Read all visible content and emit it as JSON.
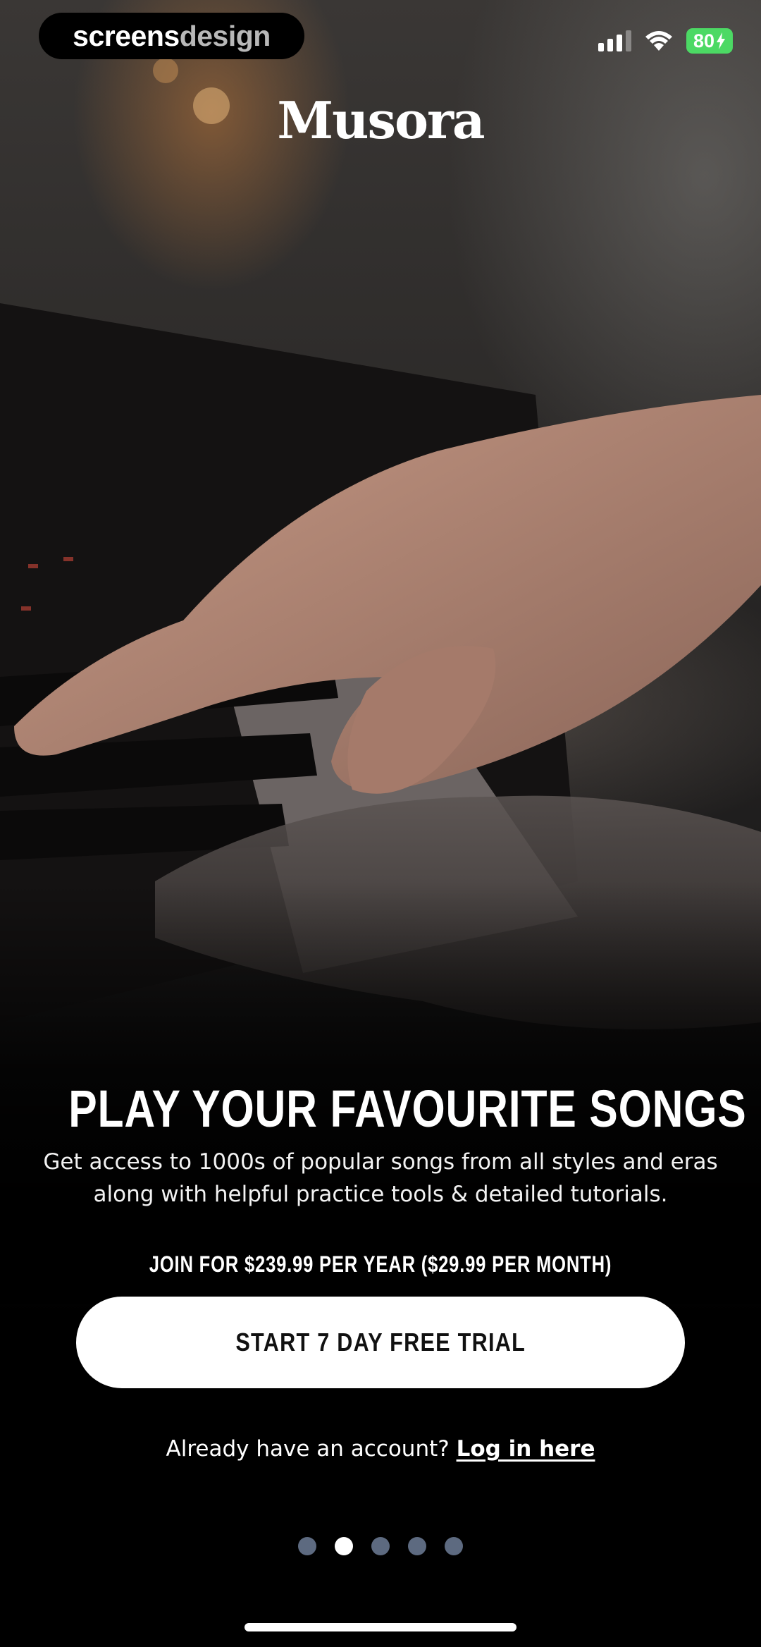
{
  "watermark": {
    "part1": "screens",
    "part2": "design"
  },
  "status_bar": {
    "battery": "80",
    "charging_icon": "bolt-icon",
    "wifi_icon": "wifi-icon",
    "signal_icon": "cellular-signal-icon"
  },
  "brand": {
    "logo_text": "Musora"
  },
  "hero": {
    "headline": "PLAY YOUR FAVOURITE SONGS",
    "subtitle": "Get access to 1000s of popular songs from all styles and eras along with helpful practice tools & detailed tutorials."
  },
  "pricing": {
    "label": "JOIN FOR $239.99 PER YEAR ($29.99 PER MONTH)"
  },
  "cta": {
    "label": "START 7 DAY FREE TRIAL"
  },
  "login": {
    "prompt": "Already have an account?",
    "link": "Log in here"
  },
  "pagination": {
    "total": 5,
    "active_index": 1
  },
  "colors": {
    "cta_bg": "#ffffff",
    "battery": "#4cd964",
    "dot_inactive": "#5d6a80",
    "dot_active": "#ffffff"
  }
}
